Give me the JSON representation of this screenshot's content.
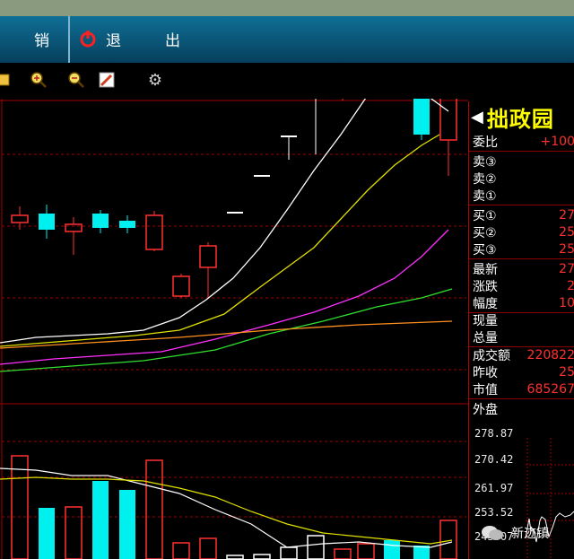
{
  "menu": {
    "items": [
      {
        "label": "销"
      },
      {
        "label": "退"
      },
      {
        "label": "出"
      }
    ]
  },
  "toolbar": {
    "icons": [
      "window-icon",
      "zoom-in-icon",
      "zoom-out-icon",
      "pencil-icon",
      "gear-icon"
    ]
  },
  "stock": {
    "name": "拙政园"
  },
  "quote": {
    "rows": [
      {
        "label": "委比",
        "value": "+100"
      },
      {
        "label": "卖③",
        "value": ""
      },
      {
        "label": "卖②",
        "value": ""
      },
      {
        "label": "卖①",
        "value": ""
      },
      {
        "label": "买①",
        "value": "27"
      },
      {
        "label": "买②",
        "value": "25"
      },
      {
        "label": "买③",
        "value": "25"
      },
      {
        "label": "最新",
        "value": "27"
      },
      {
        "label": "涨跌",
        "value": "2"
      },
      {
        "label": "幅度",
        "value": "10"
      },
      {
        "label": "现量",
        "value": ""
      },
      {
        "label": "总量",
        "value": ""
      },
      {
        "label": "成交额",
        "value": "220822"
      },
      {
        "label": "昨收",
        "value": "25"
      },
      {
        "label": "市值",
        "value": "685267"
      },
      {
        "label": "外盘",
        "value": ""
      }
    ]
  },
  "price_axis": [
    "278.87",
    "270.42",
    "261.97",
    "253.52",
    "245.07"
  ],
  "watermark": {
    "text": "新迹镇"
  },
  "colors": {
    "up": "#ff3030",
    "down": "#00f0f0",
    "ma5": "#ffffff",
    "ma10": "#e0e000",
    "ma20": "#ff30ff",
    "ma30": "#30e030",
    "ma60": "#ff9020",
    "grid": "#a00000"
  }
}
